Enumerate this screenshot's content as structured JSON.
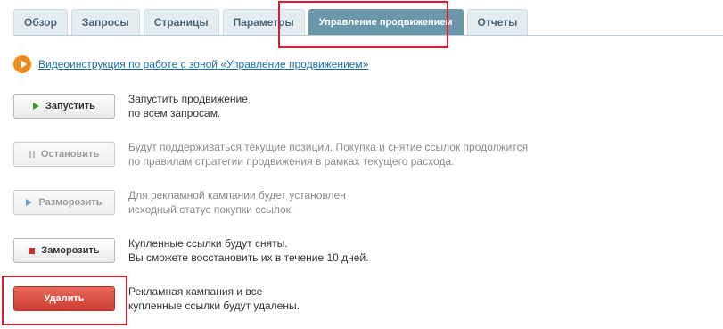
{
  "tabs": [
    {
      "label": "Обзор"
    },
    {
      "label": "Запросы"
    },
    {
      "label": "Страницы"
    },
    {
      "label": "Параметры"
    },
    {
      "label": "Управление продвижением",
      "active": true
    },
    {
      "label": "Отчеты"
    }
  ],
  "video": {
    "icon": "play-icon",
    "link_text": "Видеоинструкция по работе с зоной «Управление продвижением»"
  },
  "actions": {
    "start": {
      "label": "Запустить",
      "icon": "play-icon",
      "desc_line1": "Запустить продвижение",
      "desc_line2": "по всем запросам."
    },
    "stop": {
      "label": "Остановить",
      "icon": "pause-icon",
      "disabled": true,
      "desc_line1": "Будут поддерживаться текущие позиции. Покупка и снятие ссылок продолжится",
      "desc_line2": "по правилам стратегии продвижения в рамках текущего расхода."
    },
    "unfreeze": {
      "label": "Разморозить",
      "icon": "play-icon",
      "disabled": true,
      "desc_line1": "Для рекламной кампании будет установлен",
      "desc_line2": "исходный статус покупки ссылок."
    },
    "freeze": {
      "label": "Заморозить",
      "icon": "stop-icon",
      "desc_line1": "Купленные ссылки будут сняты.",
      "desc_line2": "Вы сможете восстановить их в течение 10 дней."
    },
    "delete": {
      "label": "Удалить",
      "desc_line1": "Рекламная кампания и все",
      "desc_line2": "купленные ссылки будут удалены."
    }
  },
  "colors": {
    "active_tab": "#6b97ab",
    "highlight": "#d1202e",
    "link": "#1a6fa3",
    "delete_button": "#d9493d"
  }
}
